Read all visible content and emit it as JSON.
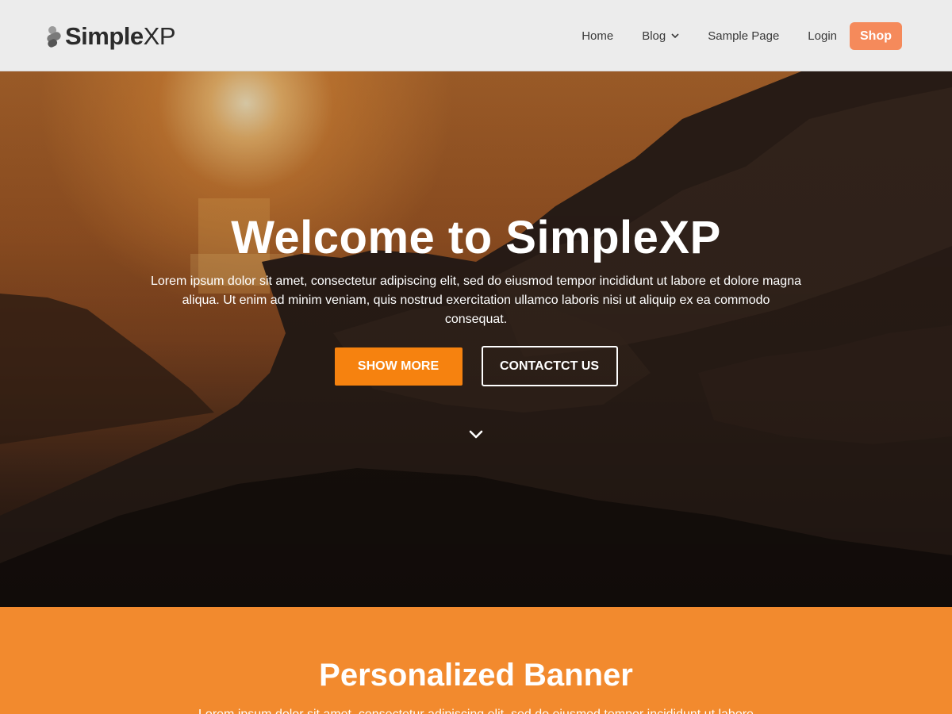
{
  "brand": {
    "name_bold": "Simple",
    "name_light": "XP"
  },
  "nav": {
    "items": [
      {
        "label": "Home"
      },
      {
        "label": "Blog"
      },
      {
        "label": "Sample Page"
      },
      {
        "label": "Login"
      }
    ],
    "shop_label": "Shop"
  },
  "hero": {
    "title": "Welcome to SimpleXP",
    "text": "Lorem ipsum dolor sit amet, consectetur adipiscing elit, sed do eiusmod tempor incididunt ut labore et dolore magna aliqua. Ut enim ad minim veniam, quis nostrud exercitation ullamco laboris nisi ut aliquip ex ea commodo consequat.",
    "primary_button": "SHOW MORE",
    "secondary_button": "CONTACTCT US"
  },
  "banner": {
    "title": "Personalized Banner",
    "text": "Lorem ipsum dolor sit amet, consectetur adipiscing elit, sed do eiusmod tempor incididunt ut labore"
  },
  "colors": {
    "accent": "#f6820f",
    "shop": "#f58a5b",
    "banner_bg": "#f28a2e",
    "header_bg": "#ececec"
  }
}
